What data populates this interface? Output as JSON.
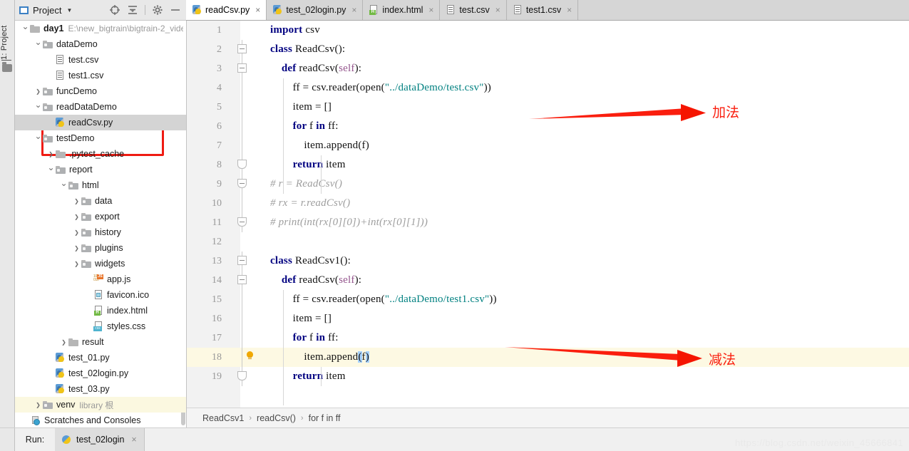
{
  "window": {
    "toolwindow_strip_label": "1: Project",
    "project_panel_title": "Project",
    "project_panel_icons": [
      "locate-target-icon",
      "collapse-all-icon",
      "settings-gear-icon",
      "minimize-icon"
    ]
  },
  "tree": {
    "root": {
      "label": "day1",
      "path": "E:\\new_bigtrain\\bigtrain-2_vide"
    },
    "items": [
      {
        "label": "day1",
        "path": "E:\\new_bigtrain\\bigtrain-2_vide",
        "icon": "folder-icon",
        "indent": 0,
        "arrow": "down",
        "bold": true,
        "state": "normal"
      },
      {
        "label": "dataDemo",
        "icon": "source-folder-icon",
        "indent": 1,
        "arrow": "down",
        "state": "normal"
      },
      {
        "label": "test.csv",
        "icon": "csv-file-icon",
        "indent": 2,
        "arrow": "none",
        "state": "normal"
      },
      {
        "label": "test1.csv",
        "icon": "csv-file-icon",
        "indent": 2,
        "arrow": "none",
        "state": "normal"
      },
      {
        "label": "funcDemo",
        "icon": "source-folder-icon",
        "indent": 1,
        "arrow": "right",
        "state": "normal"
      },
      {
        "label": "readDataDemo",
        "icon": "source-folder-icon",
        "indent": 1,
        "arrow": "down",
        "state": "normal"
      },
      {
        "label": "readCsv.py",
        "icon": "python-file-icon",
        "indent": 2,
        "arrow": "none",
        "state": "selected"
      },
      {
        "label": "testDemo",
        "icon": "source-folder-icon",
        "indent": 1,
        "arrow": "down",
        "state": "normal"
      },
      {
        "label": ".pytest_cache",
        "icon": "folder-icon",
        "indent": 2,
        "arrow": "right",
        "state": "normal"
      },
      {
        "label": "report",
        "icon": "source-folder-icon",
        "indent": 2,
        "arrow": "down",
        "state": "normal"
      },
      {
        "label": "html",
        "icon": "source-folder-icon",
        "indent": 3,
        "arrow": "down",
        "state": "normal"
      },
      {
        "label": "data",
        "icon": "source-folder-icon",
        "indent": 4,
        "arrow": "right",
        "state": "normal"
      },
      {
        "label": "export",
        "icon": "source-folder-icon",
        "indent": 4,
        "arrow": "right",
        "state": "normal"
      },
      {
        "label": "history",
        "icon": "source-folder-icon",
        "indent": 4,
        "arrow": "right",
        "state": "normal"
      },
      {
        "label": "plugins",
        "icon": "source-folder-icon",
        "indent": 4,
        "arrow": "right",
        "state": "normal"
      },
      {
        "label": "widgets",
        "icon": "source-folder-icon",
        "indent": 4,
        "arrow": "right",
        "state": "normal"
      },
      {
        "label": "app.js",
        "icon": "js-file-icon",
        "indent": 5,
        "arrow": "none",
        "state": "normal"
      },
      {
        "label": "favicon.ico",
        "icon": "ico-file-icon",
        "indent": 5,
        "arrow": "none",
        "state": "normal"
      },
      {
        "label": "index.html",
        "icon": "html-file-icon",
        "indent": 5,
        "arrow": "none",
        "state": "normal"
      },
      {
        "label": "styles.css",
        "icon": "css-file-icon",
        "indent": 5,
        "arrow": "none",
        "state": "normal"
      },
      {
        "label": "result",
        "icon": "folder-icon",
        "indent": 3,
        "arrow": "right",
        "state": "normal"
      },
      {
        "label": "test_01.py",
        "icon": "python-file-icon",
        "indent": 2,
        "arrow": "none",
        "state": "normal"
      },
      {
        "label": "test_02login.py",
        "icon": "python-file-icon",
        "indent": 2,
        "arrow": "none",
        "state": "normal"
      },
      {
        "label": "test_03.py",
        "icon": "python-file-icon",
        "indent": 2,
        "arrow": "none",
        "state": "normal"
      },
      {
        "label": "venv",
        "suffix": "library 根",
        "icon": "source-folder-icon",
        "indent": 1,
        "arrow": "right",
        "state": "highlight"
      },
      {
        "label": "Scratches and Consoles",
        "icon": "scratches-icon",
        "indent": 0,
        "arrow": "none",
        "state": "normal"
      }
    ]
  },
  "tabs": [
    {
      "label": "readCsv.py",
      "icon": "python-file-icon",
      "active": true
    },
    {
      "label": "test_02login.py",
      "icon": "python-file-icon",
      "active": false
    },
    {
      "label": "index.html",
      "icon": "html-file-icon",
      "active": false
    },
    {
      "label": "test.csv",
      "icon": "csv-file-icon",
      "active": false
    },
    {
      "label": "test1.csv",
      "icon": "csv-file-icon",
      "active": false
    }
  ],
  "editor": {
    "current_line": 18,
    "lines": [
      {
        "n": 1,
        "indent": 0,
        "segments": [
          {
            "t": "import ",
            "c": "kw"
          },
          {
            "t": "csv",
            "c": ""
          }
        ]
      },
      {
        "n": 2,
        "indent": 0,
        "segments": [
          {
            "t": "class ",
            "c": "kw"
          },
          {
            "t": "ReadCsv():",
            "c": ""
          }
        ]
      },
      {
        "n": 3,
        "indent": 1,
        "segments": [
          {
            "t": "def ",
            "c": "kw"
          },
          {
            "t": "readCsv(",
            "c": ""
          },
          {
            "t": "self",
            "c": "self"
          },
          {
            "t": "):",
            "c": ""
          }
        ]
      },
      {
        "n": 4,
        "indent": 2,
        "segments": [
          {
            "t": "ff = csv.reader(open(",
            "c": ""
          },
          {
            "t": "\"../dataDemo/test.csv\"",
            "c": "str"
          },
          {
            "t": "))",
            "c": ""
          }
        ]
      },
      {
        "n": 5,
        "indent": 2,
        "segments": [
          {
            "t": "item = []",
            "c": ""
          }
        ]
      },
      {
        "n": 6,
        "indent": 2,
        "segments": [
          {
            "t": "for ",
            "c": "kw"
          },
          {
            "t": "f ",
            "c": ""
          },
          {
            "t": "in ",
            "c": "kw"
          },
          {
            "t": "ff:",
            "c": ""
          }
        ]
      },
      {
        "n": 7,
        "indent": 3,
        "segments": [
          {
            "t": "item.append(f)",
            "c": ""
          }
        ]
      },
      {
        "n": 8,
        "indent": 2,
        "segments": [
          {
            "t": "return ",
            "c": "kw"
          },
          {
            "t": "item",
            "c": ""
          }
        ]
      },
      {
        "n": 9,
        "indent": 0,
        "segments": [
          {
            "t": "# r = ReadCsv()",
            "c": "cmt"
          }
        ]
      },
      {
        "n": 10,
        "indent": 0,
        "segments": [
          {
            "t": "# rx = r.readCsv()",
            "c": "cmt"
          }
        ]
      },
      {
        "n": 11,
        "indent": 0,
        "segments": [
          {
            "t": "# print(int(rx[0][0])+int(rx[0][1]))",
            "c": "cmt"
          }
        ]
      },
      {
        "n": 12,
        "indent": 0,
        "segments": []
      },
      {
        "n": 13,
        "indent": 0,
        "segments": [
          {
            "t": "class ",
            "c": "kw"
          },
          {
            "t": "ReadCsv1():",
            "c": ""
          }
        ]
      },
      {
        "n": 14,
        "indent": 1,
        "segments": [
          {
            "t": "def ",
            "c": "kw"
          },
          {
            "t": "readCsv(",
            "c": ""
          },
          {
            "t": "self",
            "c": "self"
          },
          {
            "t": "):",
            "c": ""
          }
        ]
      },
      {
        "n": 15,
        "indent": 2,
        "segments": [
          {
            "t": "ff = csv.reader(open(",
            "c": ""
          },
          {
            "t": "\"../dataDemo/test1.csv\"",
            "c": "str"
          },
          {
            "t": "))",
            "c": ""
          }
        ]
      },
      {
        "n": 16,
        "indent": 2,
        "segments": [
          {
            "t": "item = []",
            "c": ""
          }
        ]
      },
      {
        "n": 17,
        "indent": 2,
        "segments": [
          {
            "t": "for ",
            "c": "kw"
          },
          {
            "t": "f ",
            "c": ""
          },
          {
            "t": "in ",
            "c": "kw"
          },
          {
            "t": "ff:",
            "c": ""
          }
        ]
      },
      {
        "n": 18,
        "indent": 3,
        "segments": [
          {
            "t": "item.append",
            "c": ""
          },
          {
            "t": "(",
            "c": "hlbrk"
          },
          {
            "t": "f",
            "c": ""
          },
          {
            "t": ")",
            "c": "hlbrk"
          }
        ]
      },
      {
        "n": 19,
        "indent": 2,
        "segments": [
          {
            "t": "return ",
            "c": "kw"
          },
          {
            "t": "item",
            "c": ""
          }
        ]
      }
    ]
  },
  "breadcrumb": {
    "parts": [
      "ReadCsv1",
      "readCsv()",
      "for f in ff"
    ],
    "separator": "›"
  },
  "run_panel": {
    "label": "Run:",
    "tab_label": "test_02login",
    "close": "×"
  },
  "annotations": [
    {
      "text": "加法",
      "color": "#fa1e0e",
      "target_line": 5
    },
    {
      "text": "减法",
      "color": "#fa1e0e",
      "target_line": 18
    }
  ],
  "watermark": "https://blog.csdn.net/weixin_45666841",
  "colors": {
    "keyword": "#000080",
    "string": "#008080",
    "comment": "#9e9e9e",
    "self_param": "#94558d",
    "annotation_red": "#fa1e0e",
    "current_line_bg": "#fdf9e3",
    "selection_bg": "#d4d4d4",
    "bracket_highlight": "#a6d2ff"
  }
}
